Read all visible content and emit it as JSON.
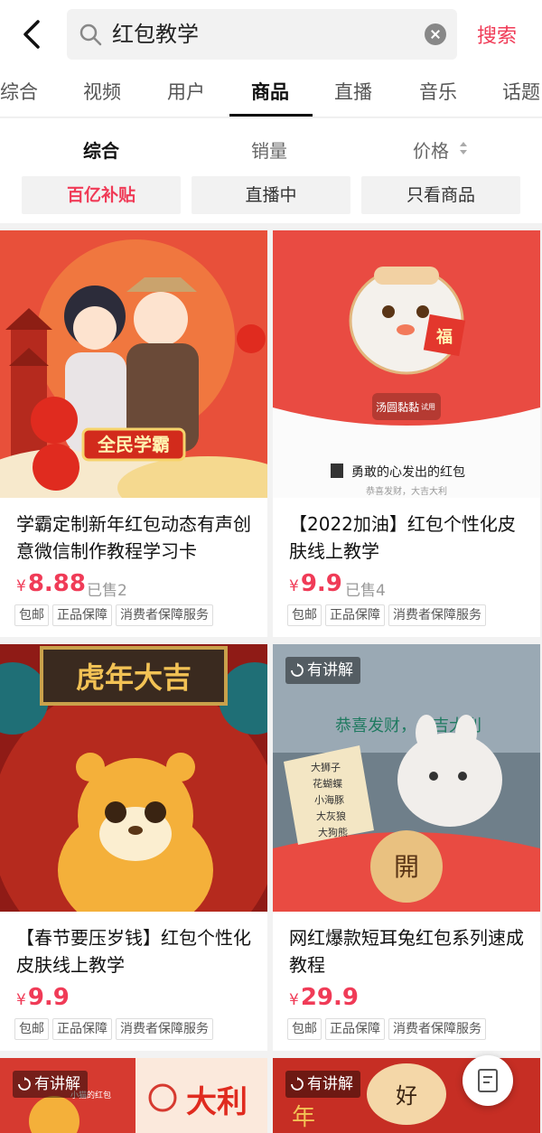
{
  "search": {
    "query": "红包教学",
    "button": "搜索"
  },
  "tabs": [
    "综合",
    "视频",
    "用户",
    "商品",
    "直播",
    "音乐",
    "话题"
  ],
  "sort": {
    "comprehensive": "综合",
    "sales": "销量",
    "price": "价格"
  },
  "chips": [
    "百亿补贴",
    "直播中",
    "只看商品"
  ],
  "products": [
    {
      "title": "学霸定制新年红包动态有声创意微信制作教程学习卡",
      "price": "8.88",
      "sold": "已售2",
      "tags": [
        "包邮",
        "正品保障",
        "消费者保障服务"
      ],
      "image_text": "全民学霸"
    },
    {
      "title": "【2022加油】红包个性化皮肤线上教学",
      "price": "9.9",
      "sold": "已售4",
      "tags": [
        "包邮",
        "正品保障",
        "消费者保障服务"
      ],
      "image_text": {
        "sticker": "福",
        "bar": "汤圆黏黏",
        "bar_badge": "试用",
        "caption": "勇敢的心发出的红包",
        "sub": "恭喜发财，大吉大利"
      }
    },
    {
      "title": "【春节要压岁钱】红包个性化皮肤线上教学",
      "price": "9.9",
      "sold": "",
      "tags": [
        "包邮",
        "正品保障",
        "消费者保障服务"
      ],
      "image_text": "虎年大吉"
    },
    {
      "title": "网红爆款短耳兔红包系列速成教程",
      "price": "29.9",
      "sold": "",
      "tags": [
        "包邮",
        "正品保障",
        "消费者保障服务"
      ],
      "image_text": {
        "label": "有讲解",
        "banner": "恭喜发财，大吉大利",
        "names": [
          "大狮子",
          "花蝴蝶",
          "小海豚",
          "大灰狼",
          "大狗熊"
        ],
        "open": "開"
      }
    }
  ],
  "peek": [
    {
      "label": "有讲解",
      "text1": "小猫的红包",
      "text2": "大利"
    },
    {
      "label": "有讲解",
      "text1": "好",
      "text2": "年"
    }
  ],
  "currency": "¥",
  "colors": {
    "accent": "#f03b57"
  },
  "icons": [
    "back-arrow-icon",
    "search-icon",
    "clear-icon",
    "sort-arrows-icon",
    "replay-icon",
    "edit-icon"
  ]
}
